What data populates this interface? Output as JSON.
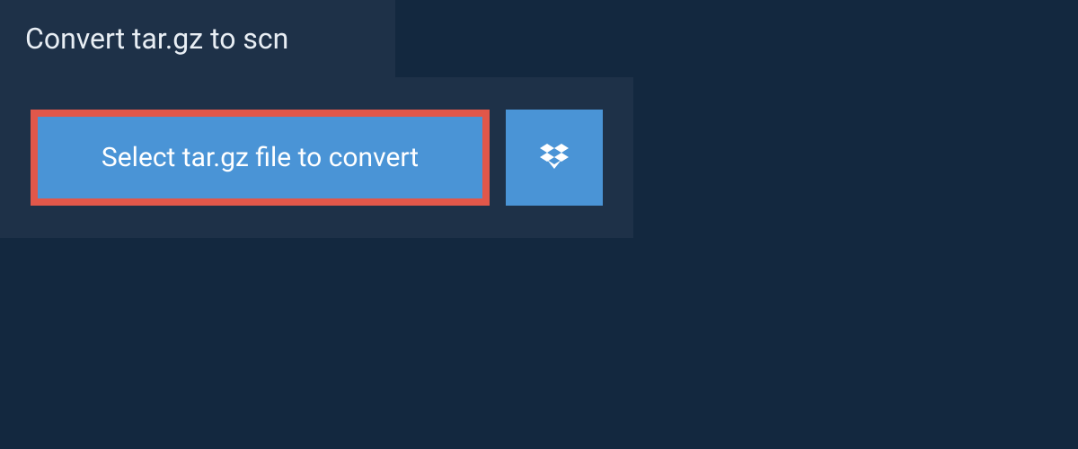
{
  "header": {
    "title": "Convert tar.gz to scn"
  },
  "upload": {
    "select_button_label": "Select tar.gz file to convert",
    "cloud_provider": "dropbox"
  },
  "colors": {
    "background": "#13283f",
    "panel": "#1e3148",
    "button": "#4a94d6",
    "highlight_border": "#e1574a",
    "text_light": "#ffffff"
  }
}
